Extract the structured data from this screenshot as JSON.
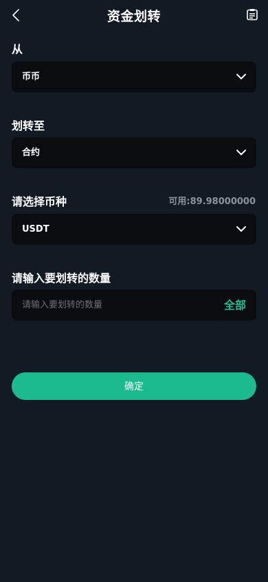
{
  "header": {
    "title": "资金划转",
    "back_icon": "chevron-left-icon",
    "record_icon": "clipboard-list-icon"
  },
  "from": {
    "label": "从",
    "value": "币币"
  },
  "to": {
    "label": "划转至",
    "value": "合约"
  },
  "coin": {
    "label": "请选择币种",
    "available": "可用:89.98000000",
    "value": "USDT"
  },
  "amount": {
    "label": "请输入要划转的数量",
    "placeholder": "请输入要划转的数量",
    "value": "",
    "all_label": "全部"
  },
  "confirm_label": "确定",
  "colors": {
    "background": "#121a24",
    "field_background": "#0a0c0f",
    "accent": "#1bbb8d",
    "muted_text": "#8c939c"
  }
}
